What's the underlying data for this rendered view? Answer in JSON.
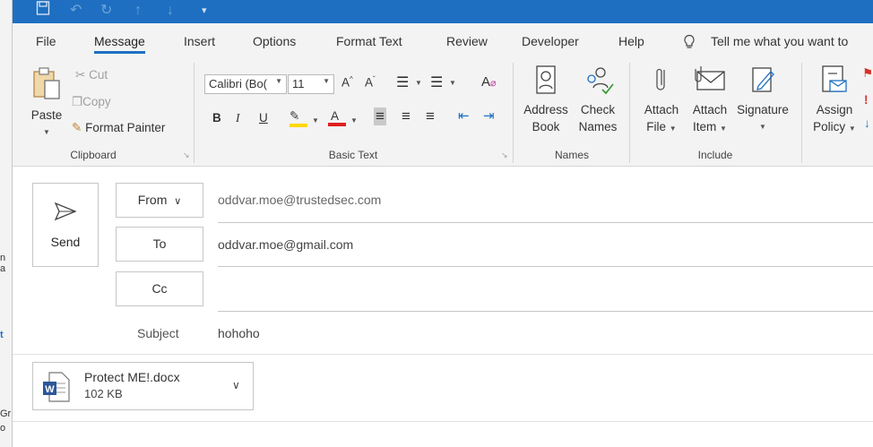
{
  "qat": {
    "save_icon": "save-icon",
    "undo_icon": "undo-icon",
    "redo_icon": "redo-icon",
    "up_icon": "up-arrow-icon",
    "down_icon": "down-arrow-icon",
    "customize_icon": "customize-qat-icon"
  },
  "left_strip": {
    "frag1": "n a",
    "frag2": "t",
    "frag3": "Gr",
    "frag4": "o"
  },
  "tabs": {
    "file": "File",
    "message": "Message",
    "insert": "Insert",
    "options": "Options",
    "format_text": "Format Text",
    "review": "Review",
    "developer": "Developer",
    "help": "Help",
    "tell_me": "Tell me what you want to"
  },
  "ribbon": {
    "clipboard": {
      "label": "Clipboard",
      "paste": "Paste",
      "cut": "Cut",
      "copy": "Copy",
      "format_painter": "Format Painter"
    },
    "basic_text": {
      "label": "Basic Text",
      "font": "Calibri (Bo(",
      "size": "11",
      "bold": "B",
      "italic": "I",
      "underline": "U",
      "highlight_color": "#ffd800",
      "font_color": "#e01f1f"
    },
    "names": {
      "label": "Names",
      "address_book_1": "Address",
      "address_book_2": "Book",
      "check_names_1": "Check",
      "check_names_2": "Names"
    },
    "include": {
      "label": "Include",
      "attach_file_1": "Attach",
      "attach_file_2": "File",
      "attach_item_1": "Attach",
      "attach_item_2": "Item",
      "signature": "Signature"
    },
    "policy": {
      "assign_1": "Assign",
      "assign_2": "Policy"
    }
  },
  "compose": {
    "send": "Send",
    "from_label": "From",
    "from_value": "oddvar.moe@trustedsec.com",
    "to_label": "To",
    "to_value": "oddvar.moe@gmail.com",
    "cc_label": "Cc",
    "cc_value": "",
    "subject_label": "Subject",
    "subject_value": "hohoho",
    "attachment": {
      "name": "Protect ME!.docx",
      "size": "102 KB",
      "icon": "word-document-icon"
    }
  },
  "colors": {
    "accent": "#1e6fc1",
    "ribbon_bg": "#f3f3f3"
  }
}
